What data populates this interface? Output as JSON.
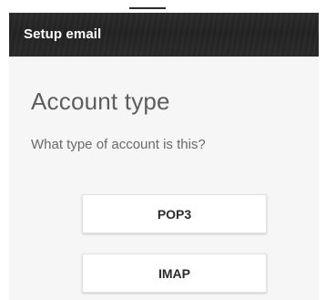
{
  "app_bar": {
    "title": "Setup email"
  },
  "content": {
    "heading": "Account type",
    "prompt": "What type of account is this?",
    "options": [
      {
        "label": "POP3"
      },
      {
        "label": "IMAP"
      }
    ]
  }
}
